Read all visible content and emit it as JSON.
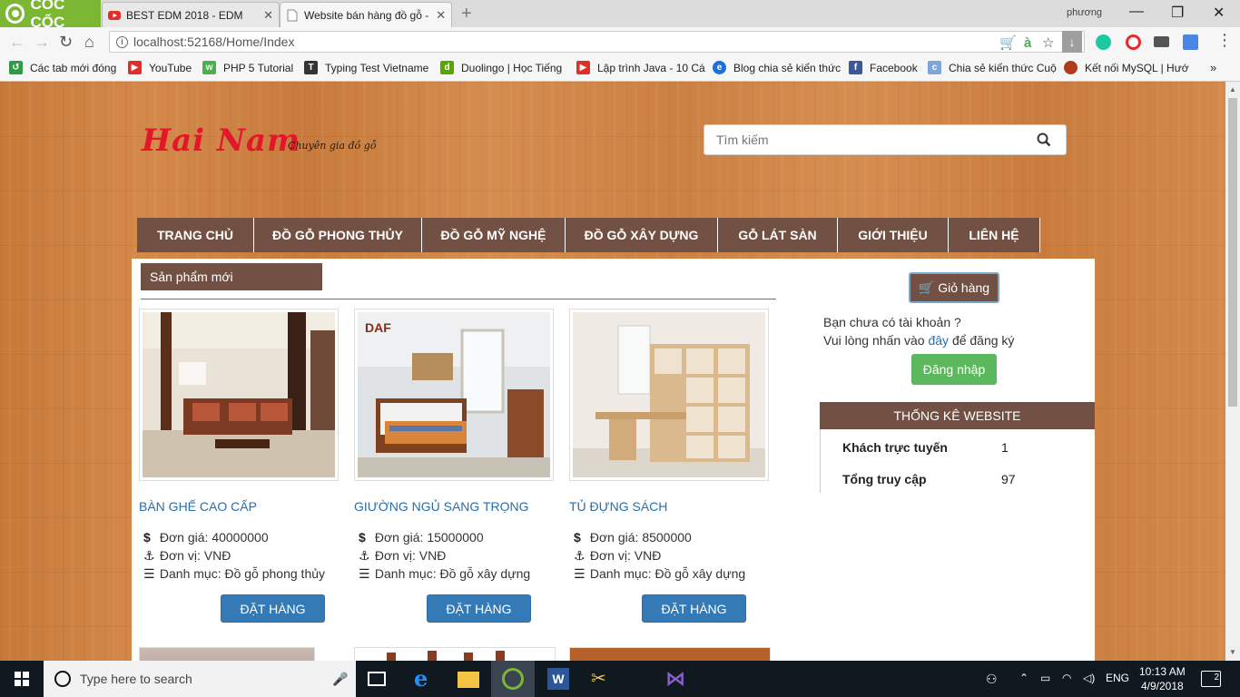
{
  "browser": {
    "brand": "CỐC CỐC",
    "tabs": [
      {
        "title": "BEST EDM 2018 - EDM",
        "icon": "youtube-icon"
      },
      {
        "title": "Website bán hàng đồ gỗ -",
        "icon": "page-icon"
      }
    ],
    "profile": "phương",
    "url": "localhost:52168/Home/Index",
    "bookmarks": [
      {
        "label": "Các tab mới đóng",
        "icon": "restore-icon",
        "color": "#2e9c46"
      },
      {
        "label": "YouTube",
        "icon": "youtube-icon",
        "color": "#e52d27"
      },
      {
        "label": "PHP 5 Tutorial",
        "icon": "w3-icon",
        "color": "#4caf50"
      },
      {
        "label": "Typing Test Vietname",
        "icon": "typing-icon",
        "color": "#333"
      },
      {
        "label": "Duolingo | Học Tiếng",
        "icon": "duolingo-icon",
        "color": "#58a700"
      },
      {
        "label": "Lập trình Java - 10 Cá",
        "icon": "youtube-icon",
        "color": "#e52d27"
      },
      {
        "label": "Blog chia sẻ kiến thức",
        "icon": "blog-icon",
        "color": "#1e6fd9"
      },
      {
        "label": "Facebook",
        "icon": "facebook-icon",
        "color": "#3b5998"
      },
      {
        "label": "Chia sẻ kiến thức Cuộ",
        "icon": "share-icon",
        "color": "#7ba7d9"
      },
      {
        "label": "Kết nối MySQL | Hướ",
        "icon": "mysql-icon",
        "color": "#b03a1a"
      }
    ]
  },
  "site": {
    "brand": "Hai Nam",
    "tagline": "Chuyên gia đồ gỗ",
    "search_placeholder": "Tìm kiếm",
    "menu": [
      "TRANG CHỦ",
      "ĐỒ GỖ PHONG THỦY",
      "ĐỒ GỖ MỸ NGHỆ",
      "ĐỒ GỖ XÂY DỰNG",
      "GỖ LÁT SÀN",
      "GIỚI THIỆU",
      "LIÊN HỆ"
    ],
    "section_title": "Sản phẩm mới",
    "price_label": "Đơn giá:",
    "unit_label": "Đơn vị:",
    "category_label": "Danh mục:",
    "order_label": "ĐẶT HÀNG",
    "products": [
      {
        "name": "BÀN GHẾ CAO CẤP",
        "price": "40000000",
        "unit": "VNĐ",
        "category": "Đồ gỗ phong thủy"
      },
      {
        "name": "GIƯỜNG NGỦ SANG TRỌNG",
        "price": "15000000",
        "unit": "VNĐ",
        "category": "Đồ gỗ xây dựng"
      },
      {
        "name": "TỦ ĐỰNG SÁCH",
        "price": "8500000",
        "unit": "VNĐ",
        "category": "Đồ gỗ xây dựng"
      }
    ],
    "cart_label": "Giỏ hàng",
    "account_line1": "Bạn chưa có tài khoản ?",
    "account_line2_pre": "Vui lòng nhấn vào",
    "account_link": "đây",
    "account_line2_post": "để đăng ký",
    "login_label": "Đăng nhập",
    "stats_title": "THỐNG KÊ WEBSITE",
    "stats": [
      {
        "label": "Khách trực tuyến",
        "value": "1"
      },
      {
        "label": "Tổng truy cập",
        "value": "97"
      }
    ]
  },
  "taskbar": {
    "search_placeholder": "Type here to search",
    "language": "ENG",
    "time": "10:13 AM",
    "date": "4/9/2018",
    "notifications": "2"
  }
}
